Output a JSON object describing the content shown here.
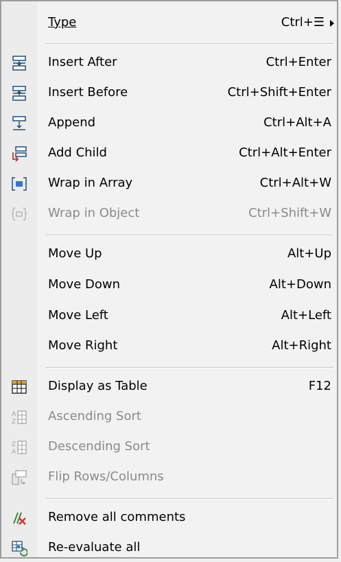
{
  "menu": {
    "items": [
      {
        "label": "Type",
        "shortcut": "Ctrl+☰",
        "icon": "",
        "has_submenu": true,
        "enabled": true
      },
      {
        "label": "Insert After",
        "shortcut": "Ctrl+Enter",
        "icon": "insert-after-icon",
        "enabled": true
      },
      {
        "label": "Insert Before",
        "shortcut": "Ctrl+Shift+Enter",
        "icon": "insert-before-icon",
        "enabled": true
      },
      {
        "label": "Append",
        "shortcut": "Ctrl+Alt+A",
        "icon": "append-icon",
        "enabled": true
      },
      {
        "label": "Add Child",
        "shortcut": "Ctrl+Alt+Enter",
        "icon": "add-child-icon",
        "enabled": true
      },
      {
        "label": "Wrap in Array",
        "shortcut": "Ctrl+Alt+W",
        "icon": "wrap-array-icon",
        "enabled": true
      },
      {
        "label": "Wrap in Object",
        "shortcut": "Ctrl+Shift+W",
        "icon": "wrap-object-icon",
        "enabled": false
      },
      {
        "label": "Move Up",
        "shortcut": "Alt+Up",
        "icon": "",
        "enabled": true
      },
      {
        "label": "Move Down",
        "shortcut": "Alt+Down",
        "icon": "",
        "enabled": true
      },
      {
        "label": "Move Left",
        "shortcut": "Alt+Left",
        "icon": "",
        "enabled": true
      },
      {
        "label": "Move Right",
        "shortcut": "Alt+Right",
        "icon": "",
        "enabled": true
      },
      {
        "label": "Display as Table",
        "shortcut": "F12",
        "icon": "table-icon",
        "enabled": true
      },
      {
        "label": "Ascending Sort",
        "shortcut": "",
        "icon": "sort-ascending-icon",
        "enabled": false
      },
      {
        "label": "Descending Sort",
        "shortcut": "",
        "icon": "sort-descending-icon",
        "enabled": false
      },
      {
        "label": "Flip Rows/Columns",
        "shortcut": "",
        "icon": "flip-rows-columns-icon",
        "enabled": false
      },
      {
        "label": "Remove all comments",
        "shortcut": "",
        "icon": "remove-comments-icon",
        "enabled": true
      },
      {
        "label": "Re-evaluate all",
        "shortcut": "",
        "icon": "re-evaluate-icon",
        "enabled": true
      }
    ]
  }
}
